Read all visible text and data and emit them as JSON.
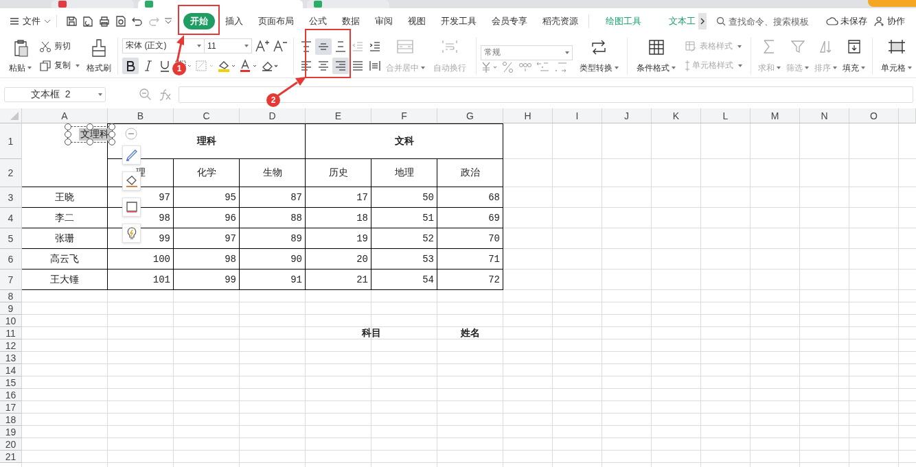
{
  "menu_bar": {
    "file": "文件",
    "tabs": [
      {
        "label": "开始",
        "selected": true,
        "kind": "main"
      },
      {
        "label": "插入",
        "selected": false,
        "kind": "main"
      },
      {
        "label": "页面布局",
        "selected": false,
        "kind": "main"
      },
      {
        "label": "公式",
        "selected": false,
        "kind": "main"
      },
      {
        "label": "数据",
        "selected": false,
        "kind": "main"
      },
      {
        "label": "审阅",
        "selected": false,
        "kind": "main"
      },
      {
        "label": "视图",
        "selected": false,
        "kind": "main"
      },
      {
        "label": "开发工具",
        "selected": false,
        "kind": "main"
      },
      {
        "label": "会员专享",
        "selected": false,
        "kind": "main"
      },
      {
        "label": "稻壳资源",
        "selected": false,
        "kind": "main"
      },
      {
        "label": "绘图工具",
        "selected": false,
        "kind": "context"
      },
      {
        "label": "文本工",
        "selected": false,
        "kind": "context"
      }
    ],
    "search": {
      "placeholder": "查找命令、搜索模板"
    },
    "unsaved": "未保存",
    "collaborate": "协作"
  },
  "ribbon": {
    "paste": "粘贴",
    "cut": "剪切",
    "copy": "复制",
    "format_painter": "格式刷",
    "font_name": "宋体 (正文)",
    "font_size": "11",
    "bold": {
      "selected": true
    },
    "align_buttons": [
      {
        "kind": "top",
        "selected": false,
        "disabled": false
      },
      {
        "kind": "middle",
        "selected": true,
        "disabled": false
      },
      {
        "kind": "bottom",
        "selected": false,
        "disabled": false
      },
      {
        "kind": "outdent",
        "selected": false,
        "disabled": true
      },
      {
        "kind": "indent",
        "selected": false,
        "disabled": false
      },
      {
        "kind": "left",
        "selected": false,
        "disabled": false
      },
      {
        "kind": "center",
        "selected": false,
        "disabled": false
      },
      {
        "kind": "right",
        "selected": true,
        "disabled": false
      },
      {
        "kind": "justify",
        "selected": false,
        "disabled": false
      },
      {
        "kind": "distributed",
        "selected": false,
        "disabled": false
      }
    ],
    "merge_center": {
      "label": "合并居中",
      "disabled": true
    },
    "wrap_text": {
      "label": "自动换行",
      "disabled": true
    },
    "number_format": "常规",
    "type_convert": {
      "label": "类型转换",
      "disabled": false
    },
    "conditional_format": {
      "label": "条件格式",
      "disabled": false
    },
    "table_style": {
      "label": "表格样式",
      "disabled": true
    },
    "cell_style": {
      "label": "单元格样式",
      "disabled": true
    },
    "tools": [
      {
        "kind": "sum",
        "label": "求和",
        "disabled": true
      },
      {
        "kind": "filter",
        "label": "筛选",
        "disabled": true
      },
      {
        "kind": "sort",
        "label": "排序",
        "disabled": true
      },
      {
        "kind": "fill",
        "label": "填充",
        "disabled": false
      }
    ],
    "cell": {
      "label": "单元格",
      "disabled": false
    }
  },
  "name_box": "文本框  2",
  "sheet": {
    "columns": [
      "A",
      "B",
      "C",
      "D",
      "E",
      "F",
      "G",
      "H",
      "I",
      "J",
      "K",
      "L",
      "M",
      "N",
      "O"
    ],
    "rows": [
      "1",
      "2",
      "3",
      "4",
      "5",
      "6",
      "7",
      "8",
      "9",
      "10",
      "11",
      "12",
      "13",
      "14",
      "15",
      "16",
      "17",
      "18",
      "19",
      "20",
      "21"
    ]
  },
  "browser_tabs": [
    {
      "selected": false
    },
    {
      "selected": true
    },
    {
      "selected": false
    }
  ],
  "table": {
    "groups": [
      {
        "label": "理科",
        "subjects": [
          "理",
          "化学",
          "生物"
        ]
      },
      {
        "label": "文科",
        "subjects": [
          "历史",
          "地理",
          "政治"
        ]
      }
    ],
    "students": [
      {
        "name": "王晓",
        "scores": [
          "97",
          "95",
          "87",
          "17",
          "50",
          "68"
        ]
      },
      {
        "name": "李二",
        "scores": [
          "98",
          "96",
          "88",
          "18",
          "51",
          "69"
        ]
      },
      {
        "name": "张珊",
        "scores": [
          "99",
          "97",
          "89",
          "19",
          "52",
          "70"
        ]
      },
      {
        "name": "高云飞",
        "scores": [
          "100",
          "98",
          "90",
          "20",
          "53",
          "71"
        ]
      },
      {
        "name": "王大锤",
        "scores": [
          "101",
          "99",
          "91",
          "21",
          "54",
          "72"
        ]
      }
    ]
  },
  "labels_row_11": [
    "科目",
    "姓名"
  ],
  "text_box": "文理科",
  "annotations": [
    {
      "number": "1"
    },
    {
      "number": "2"
    }
  ]
}
